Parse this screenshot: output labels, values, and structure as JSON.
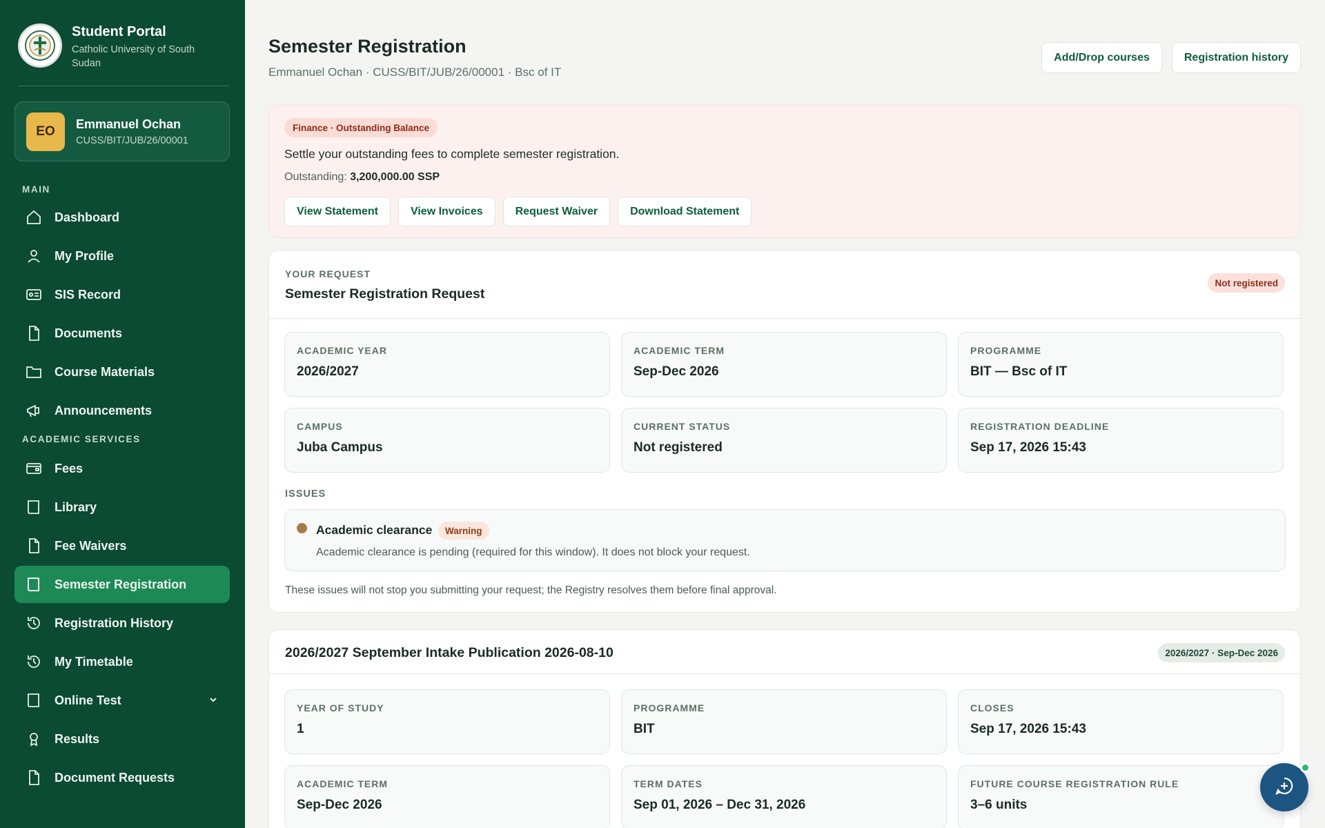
{
  "brand": {
    "title": "Student Portal",
    "subtitle": "Catholic University of South Sudan"
  },
  "user": {
    "initials": "EO",
    "name": "Emmanuel Ochan",
    "id": "CUSS/BIT/JUB/26/00001"
  },
  "nav": {
    "main_label": "MAIN",
    "main_items": [
      {
        "label": "Dashboard",
        "icon": "home-icon"
      },
      {
        "label": "My Profile",
        "icon": "user-icon"
      },
      {
        "label": "SIS Record",
        "icon": "id-card-icon"
      },
      {
        "label": "Documents",
        "icon": "document-icon"
      },
      {
        "label": "Course Materials",
        "icon": "folder-icon"
      },
      {
        "label": "Announcements",
        "icon": "megaphone-icon"
      }
    ],
    "academic_label": "ACADEMIC SERVICES",
    "academic_items": [
      {
        "label": "Fees",
        "icon": "wallet-icon"
      },
      {
        "label": "Library",
        "icon": "book-icon"
      },
      {
        "label": "Fee Waivers",
        "icon": "document-icon"
      },
      {
        "label": "Semester Registration",
        "icon": "book-icon",
        "active": true
      },
      {
        "label": "Registration History",
        "icon": "history-icon"
      },
      {
        "label": "My Timetable",
        "icon": "history-icon"
      },
      {
        "label": "Online Test",
        "icon": "book-icon",
        "has_submenu": true
      },
      {
        "label": "Results",
        "icon": "award-icon"
      },
      {
        "label": "Document Requests",
        "icon": "document-icon"
      }
    ]
  },
  "header": {
    "title": "Semester Registration",
    "subtitle": "Emmanuel Ochan · CUSS/BIT/JUB/26/00001 · Bsc of IT",
    "add_drop_label": "Add/Drop courses",
    "history_label": "Registration history"
  },
  "finance": {
    "badge": "Finance · Outstanding Balance",
    "message": "Settle your outstanding fees to complete semester registration.",
    "outstanding_label": "Outstanding:",
    "outstanding_value": "3,200,000.00 SSP",
    "buttons": [
      "View Statement",
      "View Invoices",
      "Request Waiver",
      "Download Statement"
    ]
  },
  "request": {
    "eyebrow": "YOUR REQUEST",
    "title": "Semester Registration Request",
    "status": "Not registered",
    "fields": [
      {
        "label": "ACADEMIC YEAR",
        "value": "2026/2027"
      },
      {
        "label": "ACADEMIC TERM",
        "value": "Sep-Dec 2026"
      },
      {
        "label": "PROGRAMME",
        "value": "BIT — Bsc of IT"
      },
      {
        "label": "CAMPUS",
        "value": "Juba Campus"
      },
      {
        "label": "CURRENT STATUS",
        "value": "Not registered"
      },
      {
        "label": "REGISTRATION DEADLINE",
        "value": "Sep 17, 2026 15:43"
      }
    ],
    "issues_label": "ISSUES",
    "issue": {
      "title": "Academic clearance",
      "severity": "Warning",
      "description": "Academic clearance is pending (required for this window). It does not block your request."
    },
    "note": "These issues will not stop you submitting your request; the Registry resolves them before final approval."
  },
  "publication": {
    "title": "2026/2027 September Intake Publication 2026-08-10",
    "term_badge": "2026/2027 · Sep-Dec 2026",
    "fields": [
      {
        "label": "YEAR OF STUDY",
        "value": "1"
      },
      {
        "label": "PROGRAMME",
        "value": "BIT"
      },
      {
        "label": "CLOSES",
        "value": "Sep 17, 2026 15:43"
      },
      {
        "label": "ACADEMIC TERM",
        "value": "Sep-Dec 2026"
      },
      {
        "label": "TERM DATES",
        "value": "Sep 01, 2026 – Dec 31, 2026"
      },
      {
        "label": "FUTURE COURSE REGISTRATION RULE",
        "value": "3–6 units"
      }
    ]
  },
  "colors": {
    "sidebar": "#0b4a33",
    "active_nav": "#1d8a55",
    "accent_text": "#0d5c3c",
    "finance_bg": "#fdf1ef",
    "chat_button": "#1d5582"
  }
}
